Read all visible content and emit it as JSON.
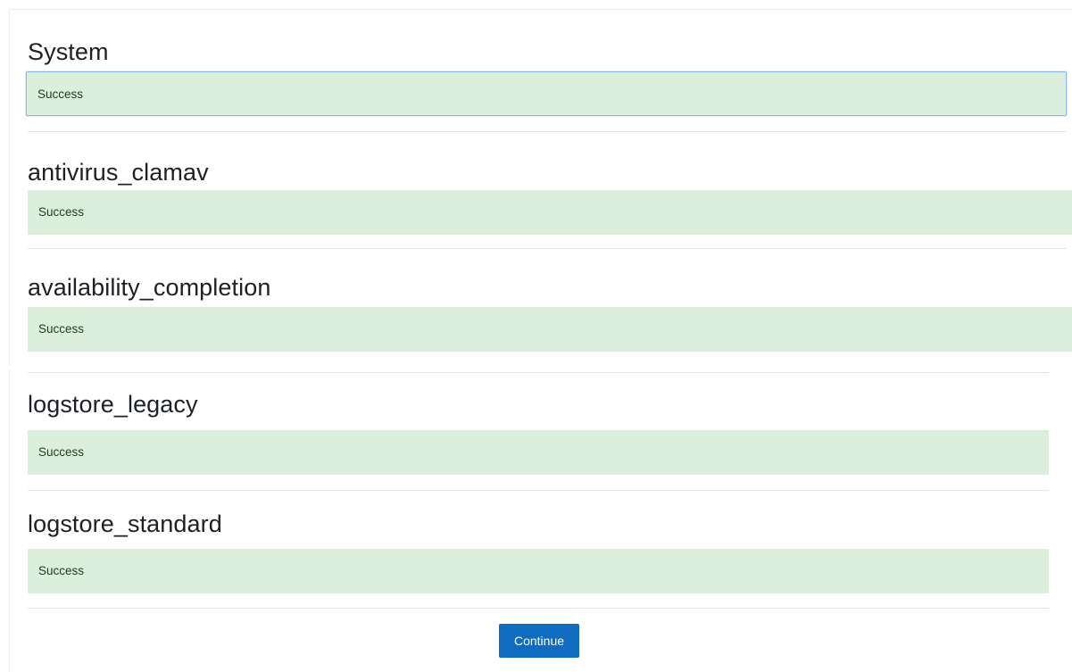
{
  "sections": [
    {
      "title": "System",
      "status": "Success"
    },
    {
      "title": "antivirus_clamav",
      "status": "Success"
    },
    {
      "title": "availability_completion",
      "status": "Success"
    },
    {
      "title": "logstore_legacy",
      "status": "Success"
    },
    {
      "title": "logstore_standard",
      "status": "Success"
    }
  ],
  "continue_label": "Continue",
  "colors": {
    "success_bg": "#dcefdc",
    "success_text": "#1c3f1c",
    "primary_button": "#0f6cbf"
  }
}
